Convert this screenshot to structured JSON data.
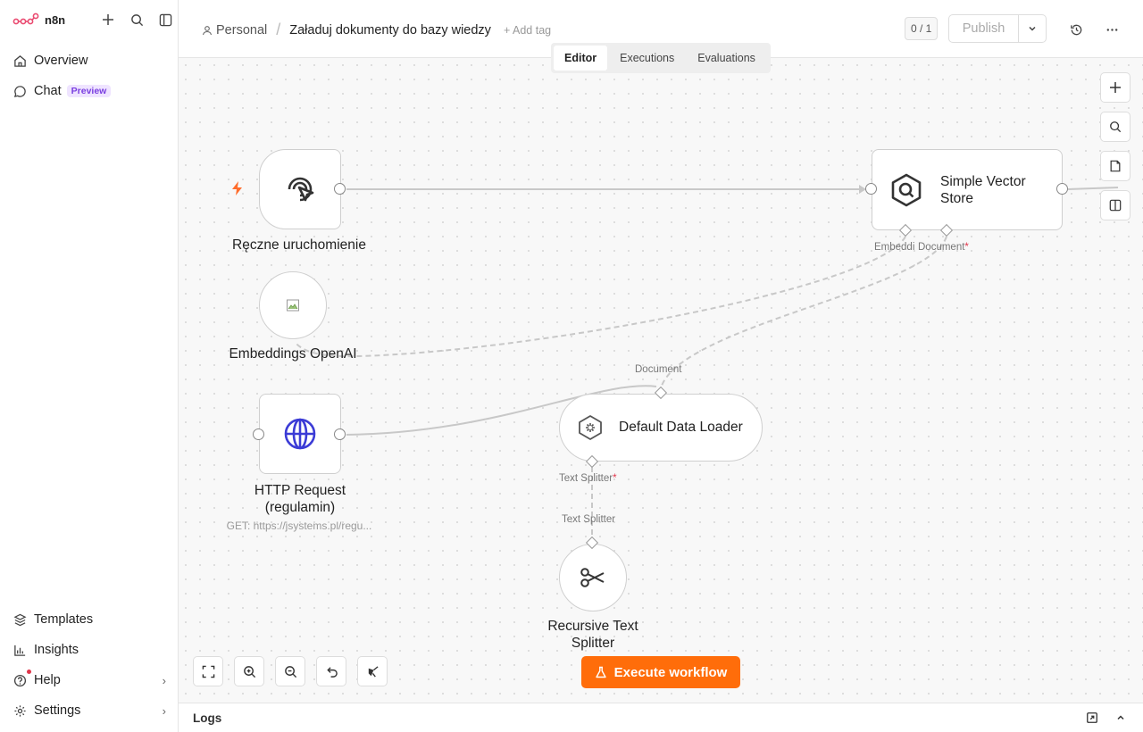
{
  "app": {
    "name": "n8n"
  },
  "sidebar": {
    "top_items": [
      {
        "label": "Overview",
        "icon": "home-icon"
      },
      {
        "label": "Chat",
        "icon": "chat-icon",
        "badge": "Preview"
      }
    ],
    "bottom_items": [
      {
        "label": "Templates",
        "icon": "templates-icon"
      },
      {
        "label": "Insights",
        "icon": "insights-icon"
      },
      {
        "label": "Help",
        "icon": "help-icon"
      },
      {
        "label": "Settings",
        "icon": "gear-icon"
      }
    ]
  },
  "header": {
    "project": "Personal",
    "workflow_title": "Załaduj dokumenty do bazy wiedzy",
    "add_tag": "+ Add tag",
    "counter": "0 / 1",
    "publish_label": "Publish",
    "tabs": [
      {
        "label": "Editor",
        "active": true
      },
      {
        "label": "Executions",
        "active": false
      },
      {
        "label": "Evaluations",
        "active": false
      }
    ]
  },
  "nodes": {
    "manual_trigger": {
      "label": "Ręczne uruchomienie",
      "icon": "cursor-click-icon"
    },
    "embeddings": {
      "label": "Embeddings OpenAI",
      "icon": "broken-image-icon"
    },
    "http_request": {
      "label_line1": "HTTP Request",
      "label_line2": "(regulamin)",
      "sublabel": "GET: https://jsystems.pl/regu...",
      "icon": "globe-icon"
    },
    "vector_store": {
      "label_line1": "Simple Vector",
      "label_line2": "Store",
      "icon": "vector-store-icon"
    },
    "data_loader": {
      "label": "Default Data Loader",
      "icon": "data-loader-icon"
    },
    "text_splitter": {
      "label_line1": "Recursive Text",
      "label_line2": "Splitter",
      "icon": "scissors-icon"
    }
  },
  "connection_labels": {
    "embedding": "Embeddi",
    "document": "Document",
    "required_mark": "*",
    "loader_document": "Document",
    "loader_text_splitter": "Text Splitter",
    "splitter_input": "Text Splitter"
  },
  "canvas": {
    "execute_label": "Execute workflow"
  },
  "logs": {
    "label": "Logs"
  },
  "colors": {
    "accent": "#ff6d0a",
    "brand": "#ea4b71",
    "globe": "#3b3bd6",
    "preview_badge": "#7a3fe0"
  }
}
